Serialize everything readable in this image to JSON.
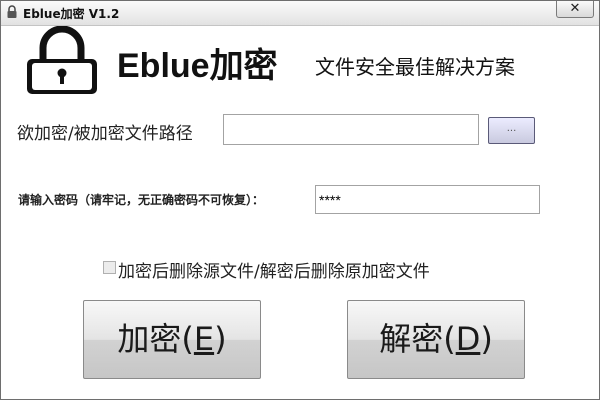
{
  "window": {
    "title": "Eblue加密 V1.2",
    "close_label": "✕"
  },
  "header": {
    "app_name": "Eblue加密",
    "slogan": "文件安全最佳解决方案",
    "logo_icon": "padlock-icon"
  },
  "path": {
    "label": "欲加密/被加密文件路径",
    "value": "",
    "browse_label": "..."
  },
  "password": {
    "label": "请输入密码（请牢记，无正确密码不可恢复）：",
    "value": "****"
  },
  "options": {
    "delete_source_label": "加密后删除源文件/解密后删除原加密文件",
    "delete_source_checked": false
  },
  "actions": {
    "encrypt_label": "加密(",
    "encrypt_key": "E",
    "encrypt_close": ")",
    "decrypt_label": "解密(",
    "decrypt_key": "D",
    "decrypt_close": ")"
  },
  "colors": {
    "window_bg": "#ffffff",
    "browse_button": "#c9cadf",
    "logo": "#111111"
  }
}
